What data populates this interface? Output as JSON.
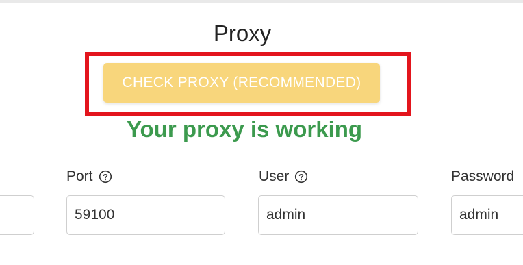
{
  "section": {
    "title": "Proxy"
  },
  "check_button": {
    "label": "CHECK PROXY (RECOMMENDED)"
  },
  "status": {
    "text": "Your proxy is working",
    "color": "#3c9a4e"
  },
  "fields": {
    "host": {
      "value": ""
    },
    "port": {
      "label": "Port",
      "value": "59100",
      "icon": "help-circle-icon"
    },
    "user": {
      "label": "User",
      "value": "admin",
      "icon": "help-circle-icon"
    },
    "password": {
      "label": "Password",
      "value": "admin"
    }
  },
  "colors": {
    "highlight": "#e3151d",
    "button_bg": "#f8d67c",
    "button_text": "#ffffff"
  }
}
